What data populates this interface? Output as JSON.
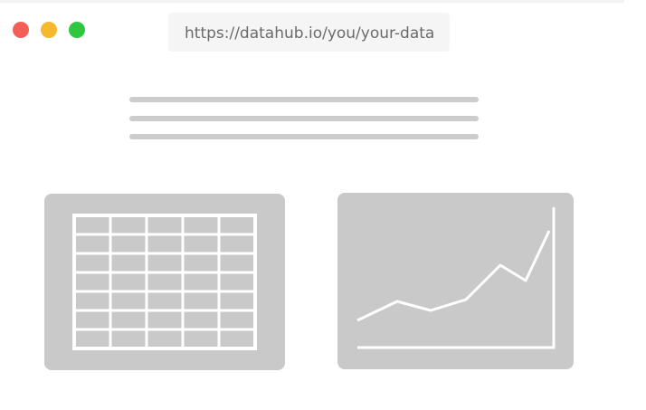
{
  "window": {
    "controls": [
      {
        "name": "close",
        "color": "#f25f57"
      },
      {
        "name": "minimize",
        "color": "#f5b82e"
      },
      {
        "name": "maximize",
        "color": "#30c740"
      }
    ]
  },
  "address_bar": {
    "url": "https://datahub.io/you/your-data"
  },
  "colors": {
    "placeholder_gray": "#cccccc",
    "card_background": "#c9c9c9",
    "stroke_white": "#ffffff"
  },
  "content": {
    "text_placeholder_lines": 3,
    "table_thumbnail": {
      "rows": 7,
      "columns": 5,
      "icon": "table-icon"
    },
    "chart_thumbnail": {
      "icon": "line-chart-icon",
      "type": "line"
    }
  }
}
